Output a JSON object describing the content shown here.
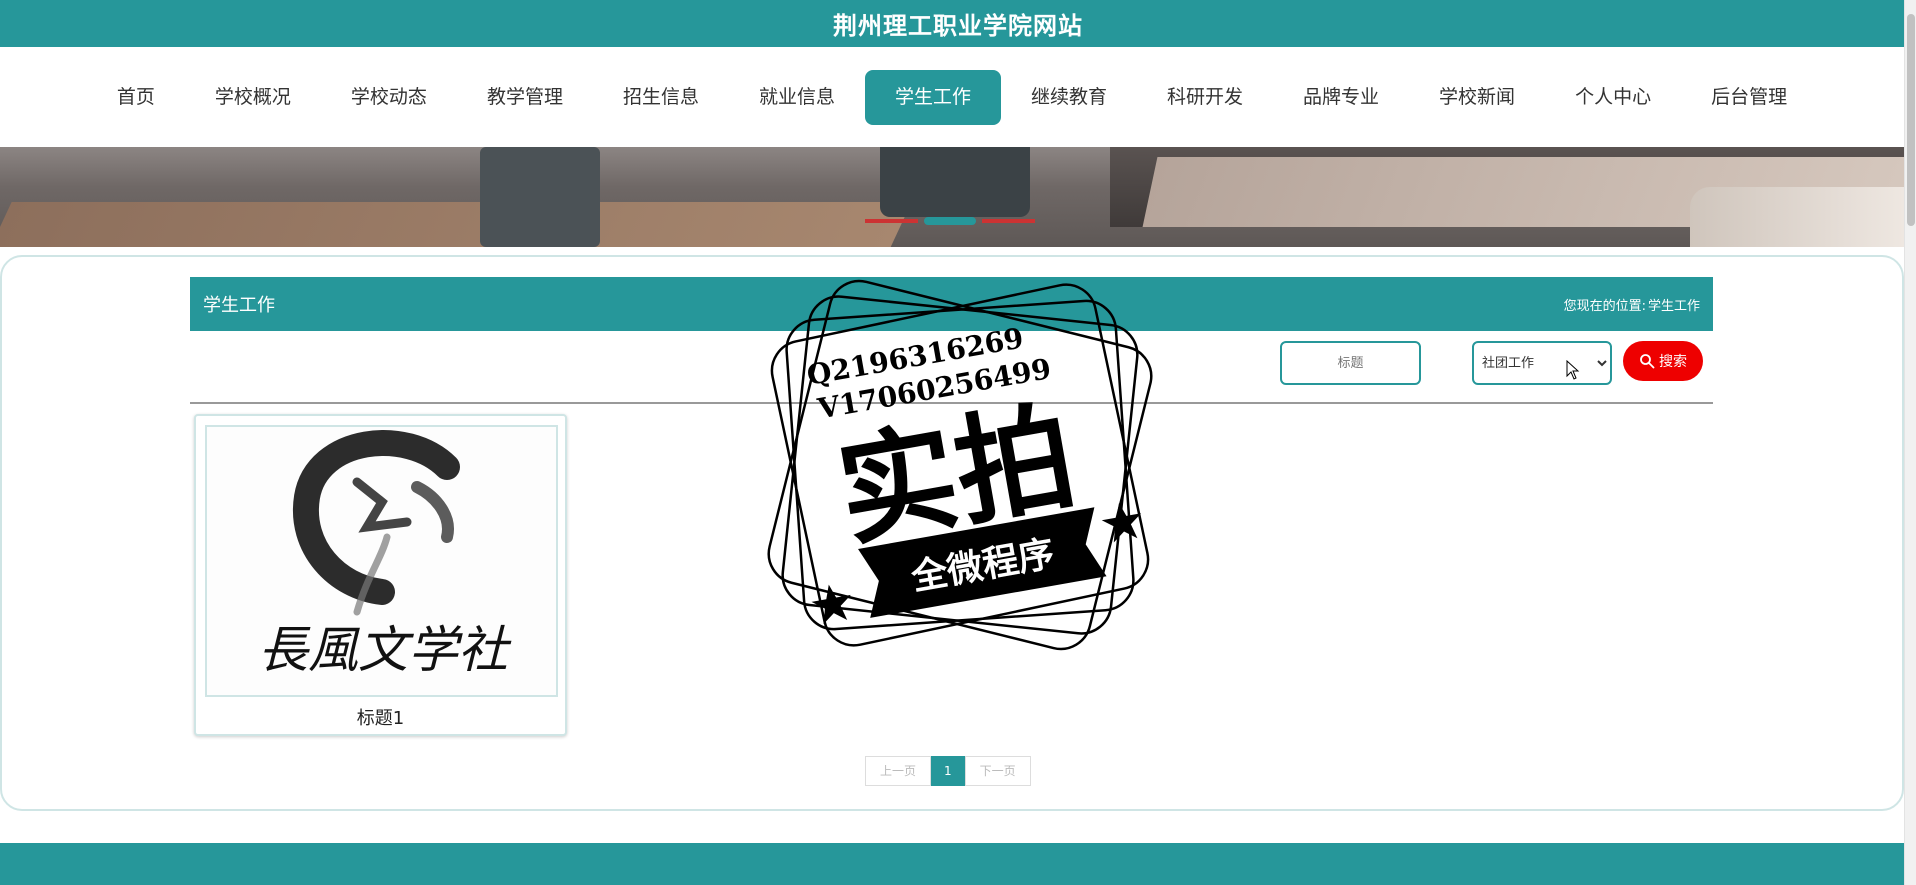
{
  "header": {
    "site_title": "荆州理工职业学院网站"
  },
  "nav": {
    "items": [
      {
        "label": "首页"
      },
      {
        "label": "学校概况"
      },
      {
        "label": "学校动态"
      },
      {
        "label": "教学管理"
      },
      {
        "label": "招生信息"
      },
      {
        "label": "就业信息"
      },
      {
        "label": "学生工作",
        "active": true
      },
      {
        "label": "继续教育"
      },
      {
        "label": "科研开发"
      },
      {
        "label": "品牌专业"
      },
      {
        "label": "学校新闻"
      },
      {
        "label": "个人中心"
      },
      {
        "label": "后台管理"
      }
    ]
  },
  "section": {
    "title": "学生工作",
    "breadcrumb_prefix": "您现在的位置:",
    "breadcrumb_current": "学生工作"
  },
  "search": {
    "title_placeholder": "标题",
    "type_selected": "社团工作",
    "button_label": "搜索"
  },
  "cards": [
    {
      "title": "标题1",
      "image_text": "長風文学社"
    }
  ],
  "pager": {
    "prev": "上一页",
    "current": "1",
    "next": "下一页"
  },
  "watermark": {
    "line1": "Q2196316269",
    "line2": "V17060256499",
    "main": "实拍",
    "ribbon": "全微程序"
  },
  "colors": {
    "brand": "#26979a",
    "search_button": "#ee0000"
  }
}
